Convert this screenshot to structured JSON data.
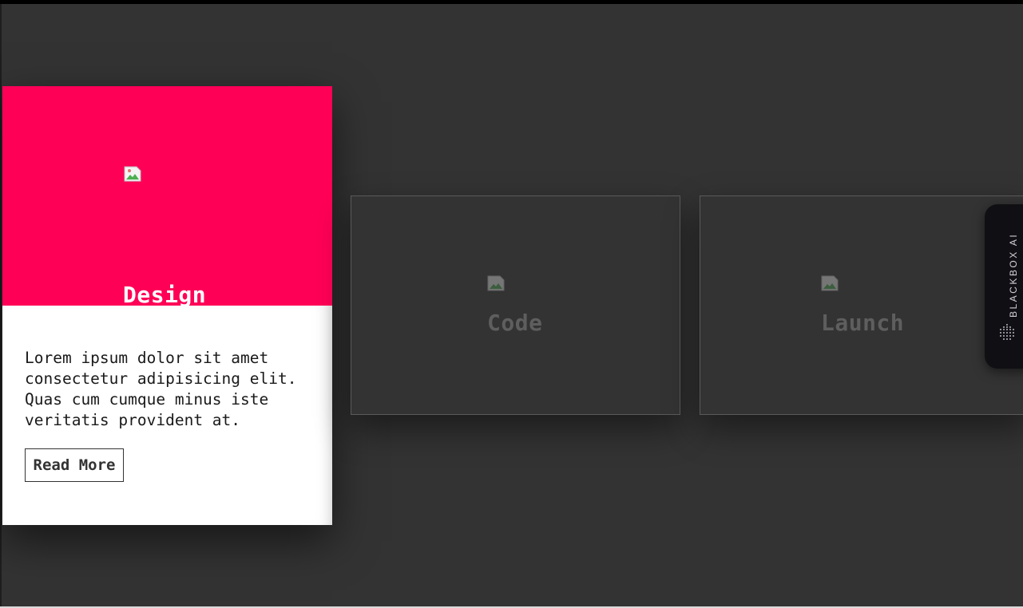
{
  "cards": [
    {
      "title": "Design",
      "icon": "broken-image-icon",
      "accent_color": "#ff0057",
      "description": "Lorem ipsum dolor sit amet consectetur adipisicing elit. Quas cum cumque minus iste veritatis provident at.",
      "button_label": "Read More",
      "state": "hovered"
    },
    {
      "title": "Code",
      "icon": "broken-image-icon",
      "state": "inactive"
    },
    {
      "title": "Launch",
      "icon": "broken-image-icon",
      "state": "inactive"
    }
  ],
  "extension": {
    "label": "BLACKBOX AI",
    "icon": "blackbox-dots-icon"
  },
  "colors": {
    "background": "#333333",
    "card_inactive": "#333333",
    "text_inactive": "#5e5e5e",
    "accent": "#ff0057"
  }
}
